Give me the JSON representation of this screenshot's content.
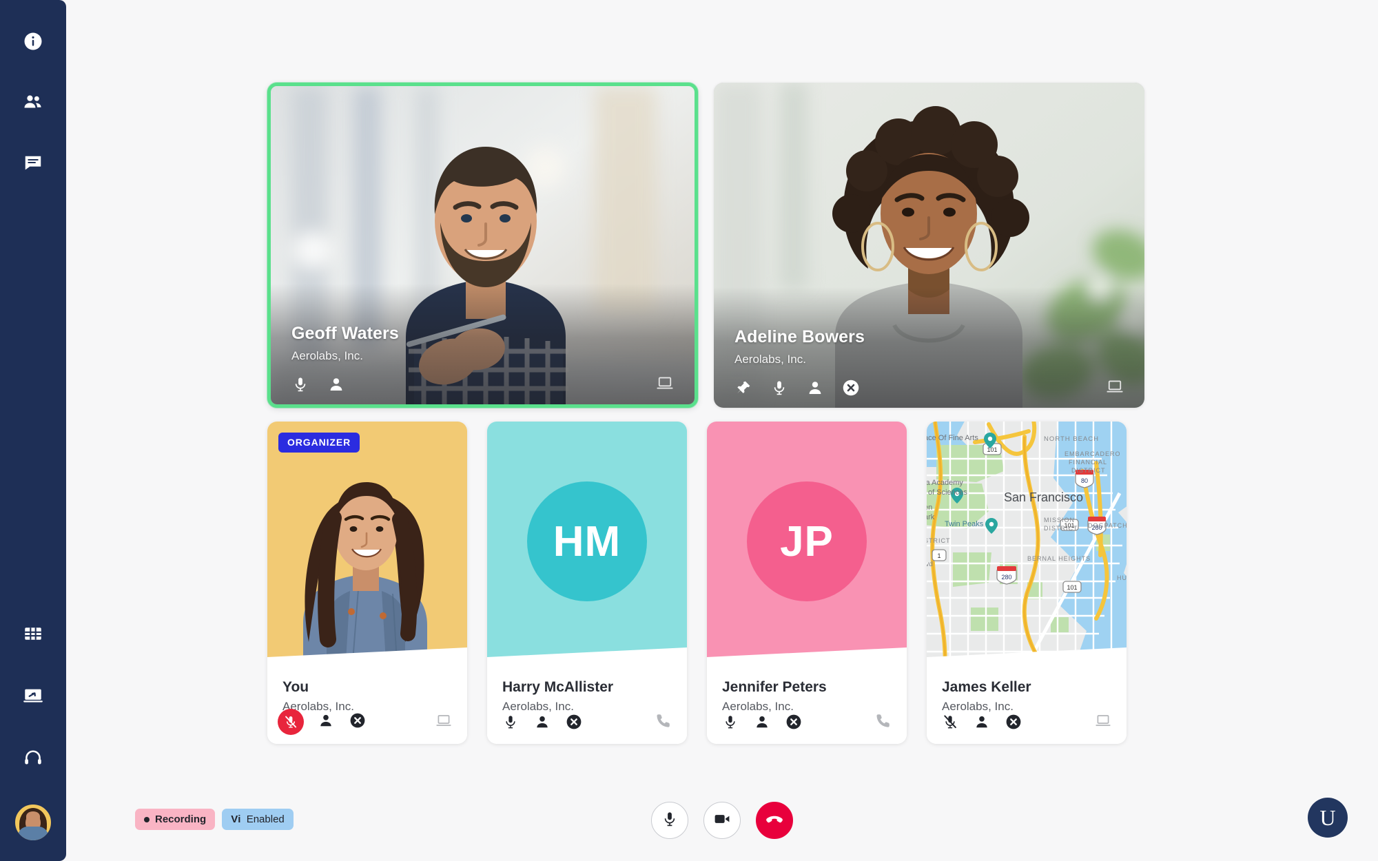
{
  "app": {
    "background_color": "#f7f7f8",
    "sidebar_color": "#1e2f56",
    "accent_active_speaker": "#5ae08c",
    "accent_danger": "#e8003c",
    "accent_organizer": "#2b2ce0"
  },
  "sidebar": {
    "top_items": [
      {
        "name": "meeting-info",
        "icon": "info-icon"
      },
      {
        "name": "participants",
        "icon": "people-icon"
      },
      {
        "name": "chat",
        "icon": "chat-icon"
      }
    ],
    "bottom_items": [
      {
        "name": "layout-grid",
        "icon": "grid-icon"
      },
      {
        "name": "screen-share",
        "icon": "screen-share-icon"
      },
      {
        "name": "support-headset",
        "icon": "headset-icon"
      }
    ],
    "avatar": {
      "name": "user-avatar",
      "background": "#f2c75c"
    }
  },
  "top_tiles": [
    {
      "name": "Geoff Waters",
      "org": "Aerolabs, Inc.",
      "active_speaker": true,
      "controls": [
        "mic-icon",
        "person-icon"
      ],
      "right_control": "laptop-icon"
    },
    {
      "name": "Adeline Bowers",
      "org": "Aerolabs, Inc.",
      "active_speaker": false,
      "controls": [
        "pin-icon",
        "mic-icon",
        "person-icon",
        "remove-icon"
      ],
      "right_control": "laptop-icon"
    }
  ],
  "bottom_tiles": [
    {
      "name": "You",
      "org": "Aerolabs, Inc.",
      "badge": "ORGANIZER",
      "media_type": "photo",
      "media_color": "#f2ca74",
      "mic_muted": true,
      "controls": [
        "mic-off-icon",
        "person-icon",
        "remove-icon"
      ],
      "right_control": "laptop-icon"
    },
    {
      "name": "Harry McAllister",
      "org": "Aerolabs, Inc.",
      "badge": "",
      "media_type": "initials",
      "initials": "HM",
      "media_color": "#8adfdf",
      "circle_color": "#35c4cd",
      "mic_muted": false,
      "controls": [
        "mic-icon",
        "person-icon",
        "remove-icon"
      ],
      "right_control": "phone-icon"
    },
    {
      "name": "Jennifer Peters",
      "org": "Aerolabs, Inc.",
      "badge": "",
      "media_type": "initials",
      "initials": "JP",
      "media_color": "#f992b3",
      "circle_color": "#f45f8e",
      "mic_muted": false,
      "controls": [
        "mic-icon",
        "person-icon",
        "remove-icon"
      ],
      "right_control": "phone-icon"
    },
    {
      "name": "James Keller",
      "org": "Aerolabs, Inc.",
      "badge": "",
      "media_type": "map",
      "media_color": "#e9eaea",
      "mic_muted": true,
      "controls": [
        "mic-off-icon",
        "person-icon",
        "remove-icon"
      ],
      "right_control": "laptop-icon"
    }
  ],
  "map": {
    "city_label": "San Francisco",
    "labels": [
      "ace Of Fine Arts",
      "NORTH BEACH",
      "EMBARCADERO",
      "FINANCIAL",
      "DISTRICT",
      "ia Academy",
      "of Sciences",
      "en",
      "ark",
      "Twin Peaks",
      "MISSION",
      "DISTRICT",
      "DOGPATCH",
      "BERNAL HEIGHTS",
      "STRICT",
      "lvd",
      "HUNTE"
    ],
    "shields": [
      "101",
      "80",
      "101",
      "280",
      "1",
      "280",
      "101"
    ]
  },
  "bottom_bar": {
    "recording_label": "Recording",
    "vi_mark": "Vi",
    "vi_label": "Enabled",
    "controls": [
      {
        "name": "toggle-microphone",
        "icon": "mic-icon"
      },
      {
        "name": "toggle-camera",
        "icon": "camera-icon"
      },
      {
        "name": "end-call",
        "icon": "hangup-icon"
      }
    ],
    "logo_letter": "U"
  }
}
